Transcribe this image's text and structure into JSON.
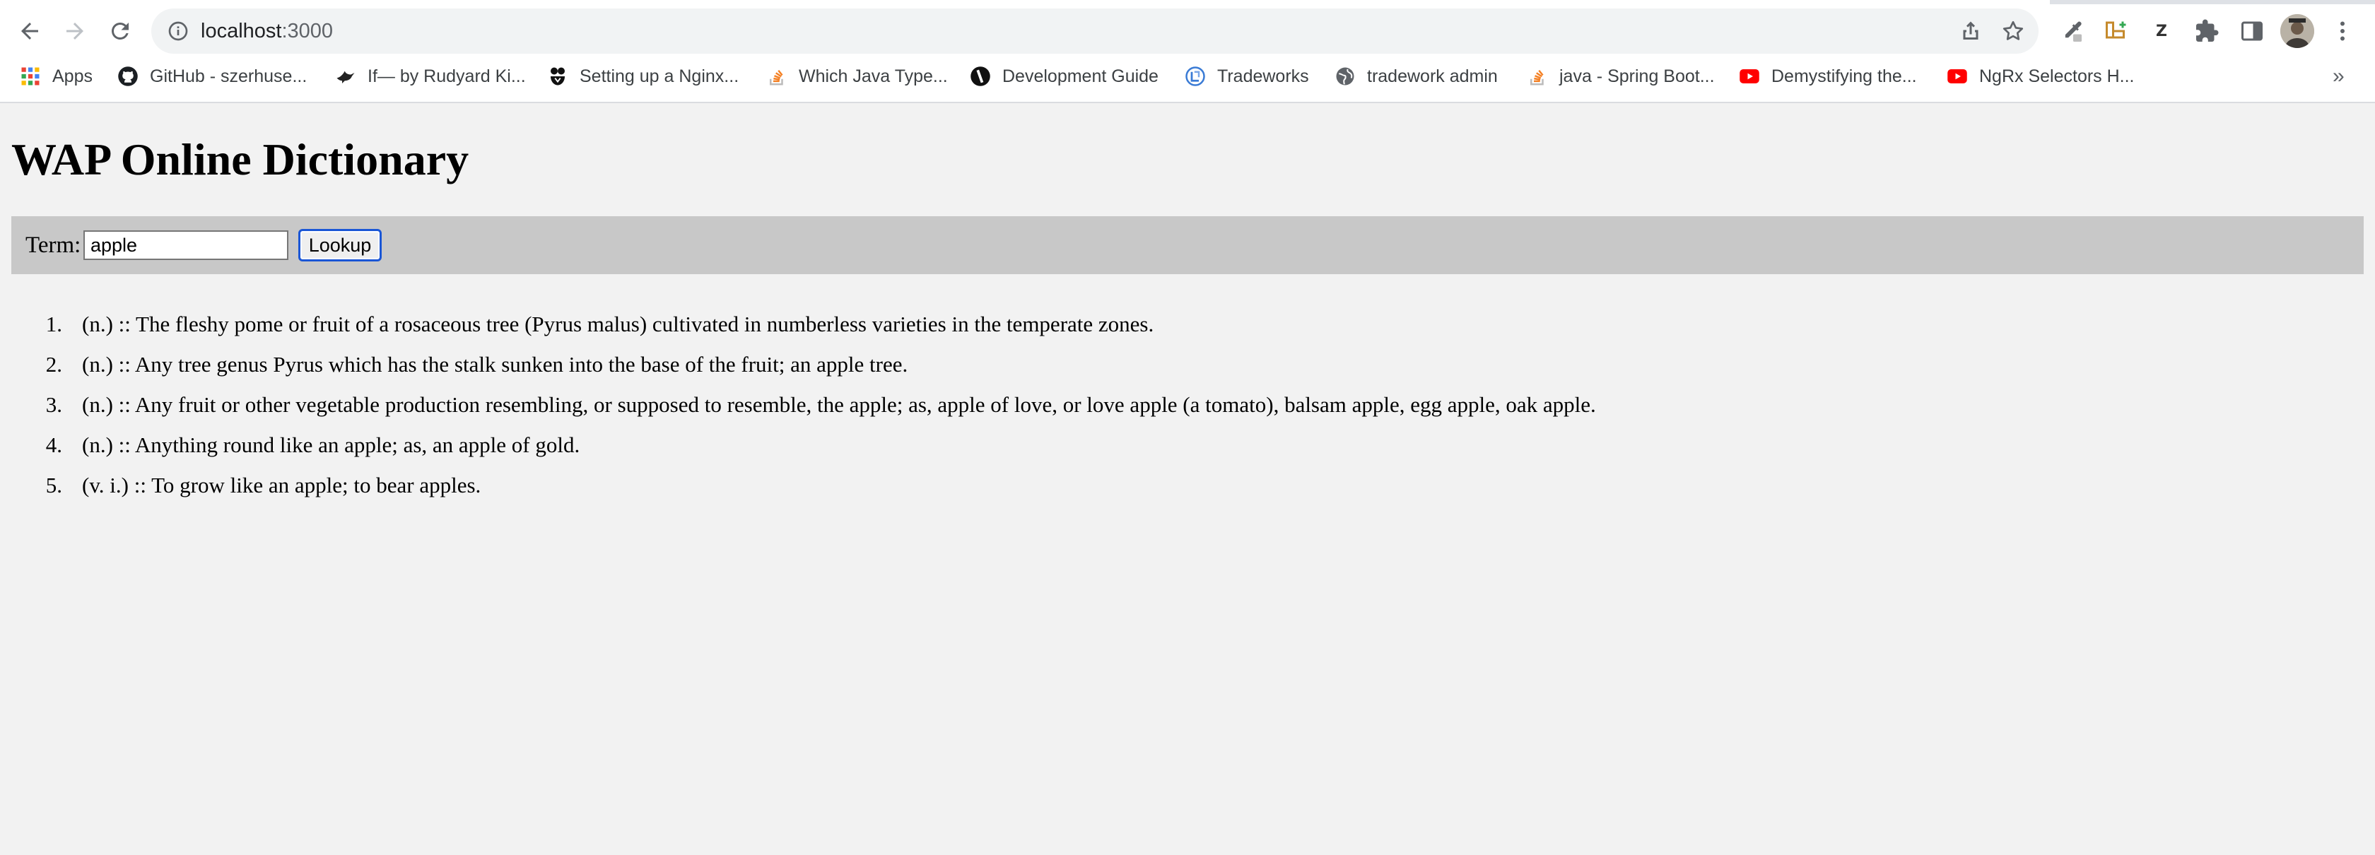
{
  "browser": {
    "url_host": "localhost",
    "url_port": ":3000",
    "bookmarks": [
      {
        "label": "Apps",
        "icon": "apps-grid-icon"
      },
      {
        "label": "GitHub - szerhuse...",
        "icon": "github-icon"
      },
      {
        "label": "If— by Rudyard Ki...",
        "icon": "bird-icon"
      },
      {
        "label": "Setting up a Nginx...",
        "icon": "nginx-icon"
      },
      {
        "label": "Which Java Type...",
        "icon": "stackoverflow-icon"
      },
      {
        "label": "Development Guide",
        "icon": "dev-guide-icon"
      },
      {
        "label": "Tradeworks",
        "icon": "tradeworks-icon"
      },
      {
        "label": "tradework admin",
        "icon": "globe-icon"
      },
      {
        "label": "java - Spring Boot...",
        "icon": "stackoverflow-icon"
      },
      {
        "label": "Demystifying the...",
        "icon": "youtube-icon"
      },
      {
        "label": "NgRx Selectors H...",
        "icon": "youtube-icon"
      }
    ],
    "bookmarks_more": "»",
    "extension_z_label": "Z"
  },
  "page": {
    "title": "WAP Online Dictionary",
    "term_label": "Term:",
    "term_value": "apple",
    "lookup_label": "Lookup"
  },
  "definitions": [
    {
      "num": "1.",
      "text": "(n.) :: The fleshy pome or fruit of a rosaceous tree (Pyrus malus) cultivated in numberless varieties in the temperate zones."
    },
    {
      "num": "2.",
      "text": "(n.) :: Any tree genus Pyrus which has the stalk sunken into the base of the fruit; an apple tree."
    },
    {
      "num": "3.",
      "text": "(n.) :: Any fruit or other vegetable production resembling, or supposed to resemble, the apple; as, apple of love, or love apple (a tomato), balsam apple, egg apple, oak apple."
    },
    {
      "num": "4.",
      "text": "(n.) :: Anything round like an apple; as, an apple of gold."
    },
    {
      "num": "5.",
      "text": "(v. i.) :: To grow like an apple; to bear apples."
    }
  ],
  "colors": {
    "page_bg": "#f2f2f2",
    "search_bar_bg": "#c8c8c8",
    "button_focus": "#1a56d6"
  }
}
